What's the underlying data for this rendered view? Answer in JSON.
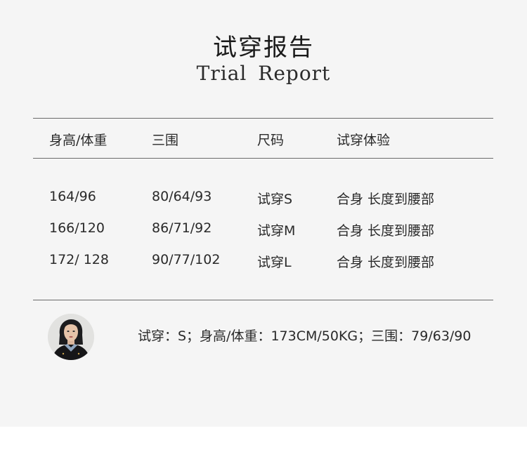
{
  "title_cn": "试穿报告",
  "title_en": "Trial Report",
  "table": {
    "headers": [
      "身高/体重",
      "三围",
      "尺码",
      "试穿体验"
    ],
    "rows": [
      [
        "164/96",
        "80/64/93",
        "试穿S",
        "合身 长度到腰部"
      ],
      [
        "166/120",
        "86/71/92",
        "试穿M",
        "合身 长度到腰部"
      ],
      [
        "172/ 128",
        "90/77/102",
        "试穿L",
        "合身 长度到腰部"
      ]
    ]
  },
  "model": {
    "avatar_icon": "model-portrait",
    "note": "试穿：S；身高/体重：173CM/50KG；三围：79/63/90"
  }
}
